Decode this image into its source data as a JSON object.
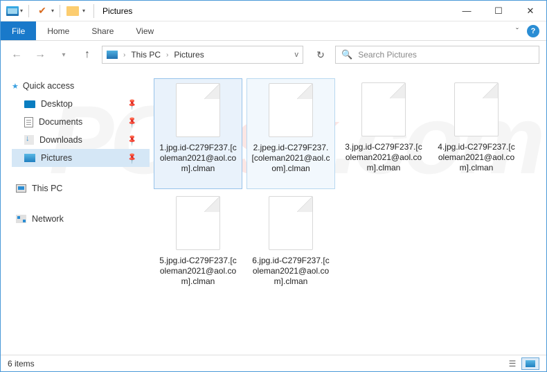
{
  "titlebar": {
    "title": "Pictures"
  },
  "window_controls": {
    "minimize": "—",
    "maximize": "☐",
    "close": "✕"
  },
  "ribbon": {
    "file": "File",
    "tabs": [
      "Home",
      "Share",
      "View"
    ],
    "expand": "ˇ",
    "help": "?"
  },
  "address": {
    "crumbs": [
      "This PC",
      "Pictures"
    ],
    "dropdown": "v",
    "refresh": "↻"
  },
  "search": {
    "placeholder": "Search Pictures"
  },
  "nav": {
    "quick_access": "Quick access",
    "items": [
      {
        "label": "Desktop"
      },
      {
        "label": "Documents"
      },
      {
        "label": "Downloads"
      },
      {
        "label": "Pictures"
      }
    ],
    "this_pc": "This PC",
    "network": "Network"
  },
  "files": [
    {
      "name": "1.jpg.id-C279F237.[coleman2021@aol.com].clman"
    },
    {
      "name": "2.jpeg.id-C279F237.[coleman2021@aol.com].clman"
    },
    {
      "name": "3.jpg.id-C279F237.[coleman2021@aol.com].clman"
    },
    {
      "name": "4.jpg.id-C279F237.[coleman2021@aol.com].clman"
    },
    {
      "name": "5.jpg.id-C279F237.[coleman2021@aol.com].clman"
    },
    {
      "name": "6.jpg.id-C279F237.[coleman2021@aol.com].clman"
    }
  ],
  "status": {
    "count": "6 items"
  },
  "watermark": {
    "a": "PC",
    "b": "risk",
    "c": ".com"
  }
}
